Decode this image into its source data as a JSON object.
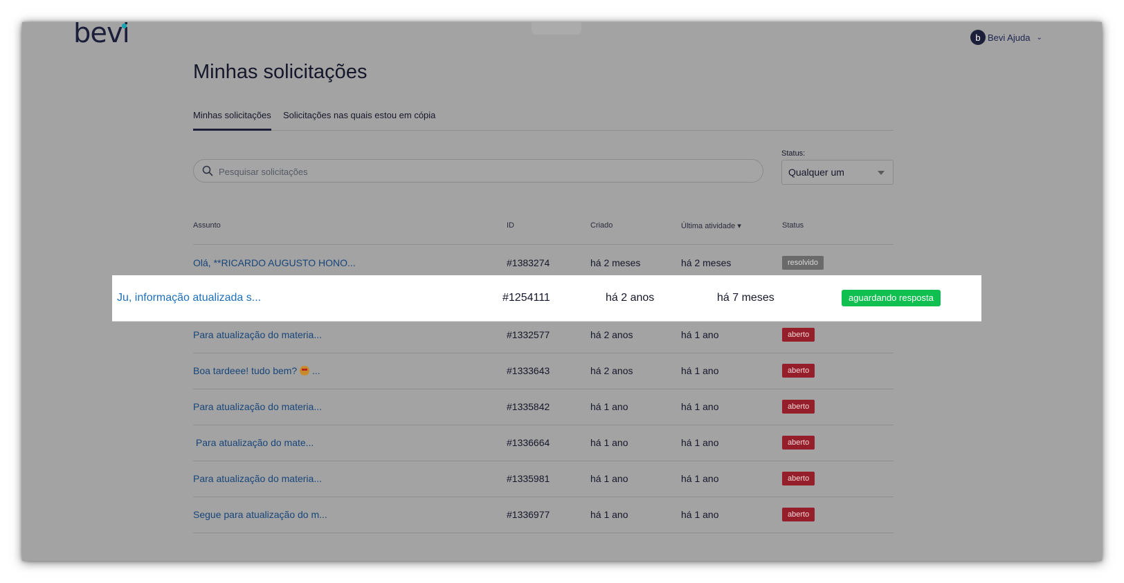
{
  "header": {
    "logo_text": "bevi",
    "user": {
      "avatar_letter": "b",
      "name": "Bevi Ajuda"
    }
  },
  "page": {
    "title": "Minhas solicitações"
  },
  "tabs": [
    {
      "label": "Minhas solicitações",
      "active": true
    },
    {
      "label": "Solicitações nas quais estou em cópia",
      "active": false
    }
  ],
  "search": {
    "placeholder": "Pesquisar solicitações",
    "value": ""
  },
  "status_filter": {
    "label": "Status:",
    "selected": "Qualquer um"
  },
  "table": {
    "columns": {
      "subject": "Assunto",
      "id": "ID",
      "created": "Criado",
      "last_activity": "Última atividade ▾",
      "status": "Status"
    },
    "rows": [
      {
        "subject": "Olá, **RICARDO AUGUSTO HONO...",
        "id": "#1383274",
        "created": "há 2 meses",
        "last_activity": "há 2 meses",
        "status": "resolvido"
      },
      {
        "subject": "Ju, informação atualizada s...",
        "id": "#1254111",
        "created": "há 2 anos",
        "last_activity": "há 7 meses",
        "status": "aguardando resposta"
      },
      {
        "subject": "Para atualização do materia...",
        "id": "#1332577",
        "created": "há 2 anos",
        "last_activity": "há 1 ano",
        "status": "aberto"
      },
      {
        "subject": "Boa tardeee! tudo bem?",
        "subject_suffix": "...",
        "id": "#1333643",
        "created": "há 2 anos",
        "last_activity": "há 1 ano",
        "status": "aberto"
      },
      {
        "subject": "Para atualização do materia...",
        "id": "#1335842",
        "created": "há 1 ano",
        "last_activity": "há 1 ano",
        "status": "aberto"
      },
      {
        "subject": " Para atualização do mate...",
        "id": "#1336664",
        "created": "há 1 ano",
        "last_activity": "há 1 ano",
        "status": "aberto"
      },
      {
        "subject": "Para atualização do materia...",
        "id": "#1335981",
        "created": "há 1 ano",
        "last_activity": "há 1 ano",
        "status": "aberto"
      },
      {
        "subject": "Segue para atualização do m...",
        "id": "#1336977",
        "created": "há 1 ano",
        "last_activity": "há 1 ano",
        "status": "aberto"
      }
    ]
  },
  "colors": {
    "overlay": "#a3a3a3",
    "link": "#17457a",
    "highlight_link": "#1f6fb8",
    "badge_open": "#941e29",
    "badge_resolved": "#6a6a6a",
    "badge_waiting": "#0fbf4f"
  }
}
